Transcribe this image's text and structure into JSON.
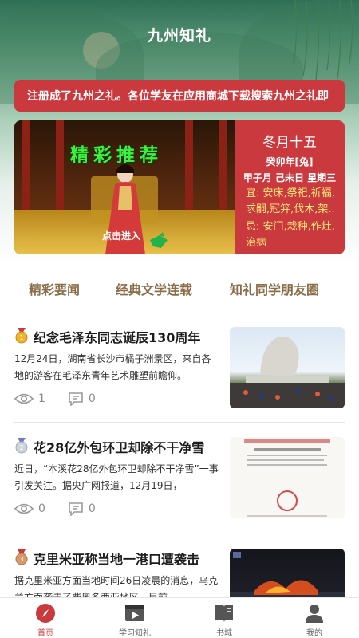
{
  "header": {
    "title": "九州知礼"
  },
  "notice": {
    "text": "注册成了九州之礼。各位学友在应用商城下载搜索九州之礼即"
  },
  "banner": {
    "label": "精彩推荐",
    "enter_label": "点击进入",
    "almanac": {
      "lunar_date": "冬月十五",
      "year": "癸卯年[兔]",
      "ganzhi": "甲子月 己未日 星期三",
      "yi": "宜: 安床,祭祀,祈福,求嗣,冠笄,伐木,架..",
      "ji": "忌: 安门,栽种,作灶,治病"
    }
  },
  "tabs": [
    "精彩要闻",
    "经典文学连载",
    "知礼同学朋友圈"
  ],
  "news": [
    {
      "medal": "gold",
      "title": "纪念毛泽东同志诞辰130周年",
      "summary": "12月24日，湖南省长沙市橘子洲景区，来自各地的游客在毛泽东青年艺术雕塑前瞻仰。",
      "views": "1",
      "comments": "0"
    },
    {
      "medal": "silver",
      "title": "花28亿外包环卫却除不干净雪",
      "summary": "近日，“本溪花28亿外包环卫却除不干净雪”一事引发关注。据央广网报道，12月19日，",
      "views": "0",
      "comments": "0"
    },
    {
      "medal": "bronze",
      "title": "克里米亚称当地一港口遭袭击",
      "summary": "据克里米亚方面当地时间26日凌晨的消息，乌克兰方面袭击了费奥多西亚地区，目前",
      "views": "",
      "comments": ""
    }
  ],
  "bottom_nav": [
    {
      "label": "首页",
      "icon": "compass-icon",
      "active": true
    },
    {
      "label": "学习知礼",
      "icon": "video-icon",
      "active": false
    },
    {
      "label": "书城",
      "icon": "book-icon",
      "active": false
    },
    {
      "label": "我的",
      "icon": "person-icon",
      "active": false
    }
  ],
  "colors": {
    "accent": "#c9393e",
    "tab_text": "#8b6d4a",
    "banner_label": "#3cf23c",
    "almanac_highlight": "#ffea7a"
  }
}
